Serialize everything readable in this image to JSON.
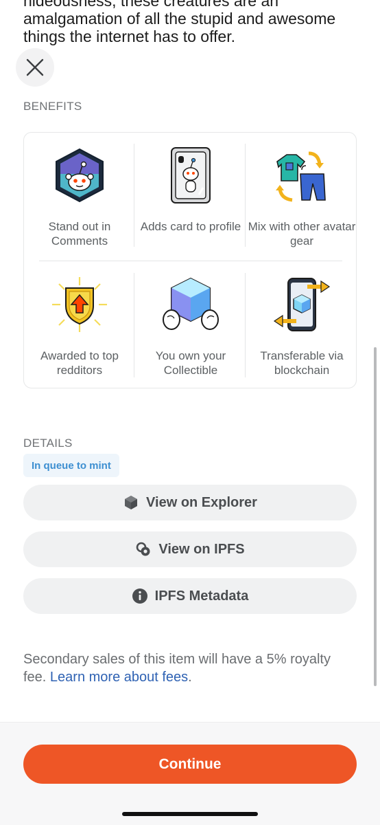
{
  "description": "hideousness, these creatures are an amalgamation of all the stupid and awesome things the internet has to offer.",
  "close": {
    "icon": "close-icon"
  },
  "benefits": {
    "heading": "BENEFITS",
    "items": [
      {
        "label": "Stand out in Comments",
        "icon": "snoo-avatar-badge-icon"
      },
      {
        "label": "Adds card to profile",
        "icon": "collectible-card-icon"
      },
      {
        "label": "Mix with other avatar gear",
        "icon": "avatar-gear-swap-icon"
      },
      {
        "label": "Awarded to top redditors",
        "icon": "award-shield-icon"
      },
      {
        "label": "You own your Collectible",
        "icon": "crystal-hands-icon"
      },
      {
        "label": "Transferable via blockchain",
        "icon": "phone-transfer-icon"
      }
    ]
  },
  "details": {
    "heading": "DETAILS",
    "status_badge": "In queue to mint",
    "buttons": [
      {
        "label": "View on Explorer",
        "icon": "cube-icon"
      },
      {
        "label": "View on IPFS",
        "icon": "ipfs-link-icon"
      },
      {
        "label": "IPFS Metadata",
        "icon": "info-icon"
      }
    ]
  },
  "royalty": {
    "text": "Secondary sales of this item will have a 5% royalty fee. ",
    "link_text": "Learn more about fees",
    "suffix": "."
  },
  "footer": {
    "continue_label": "Continue"
  },
  "colors": {
    "accent": "#ee5626",
    "link": "#2f62b3",
    "badge_text": "#3d8fd1",
    "badge_bg": "#eef5fb"
  }
}
